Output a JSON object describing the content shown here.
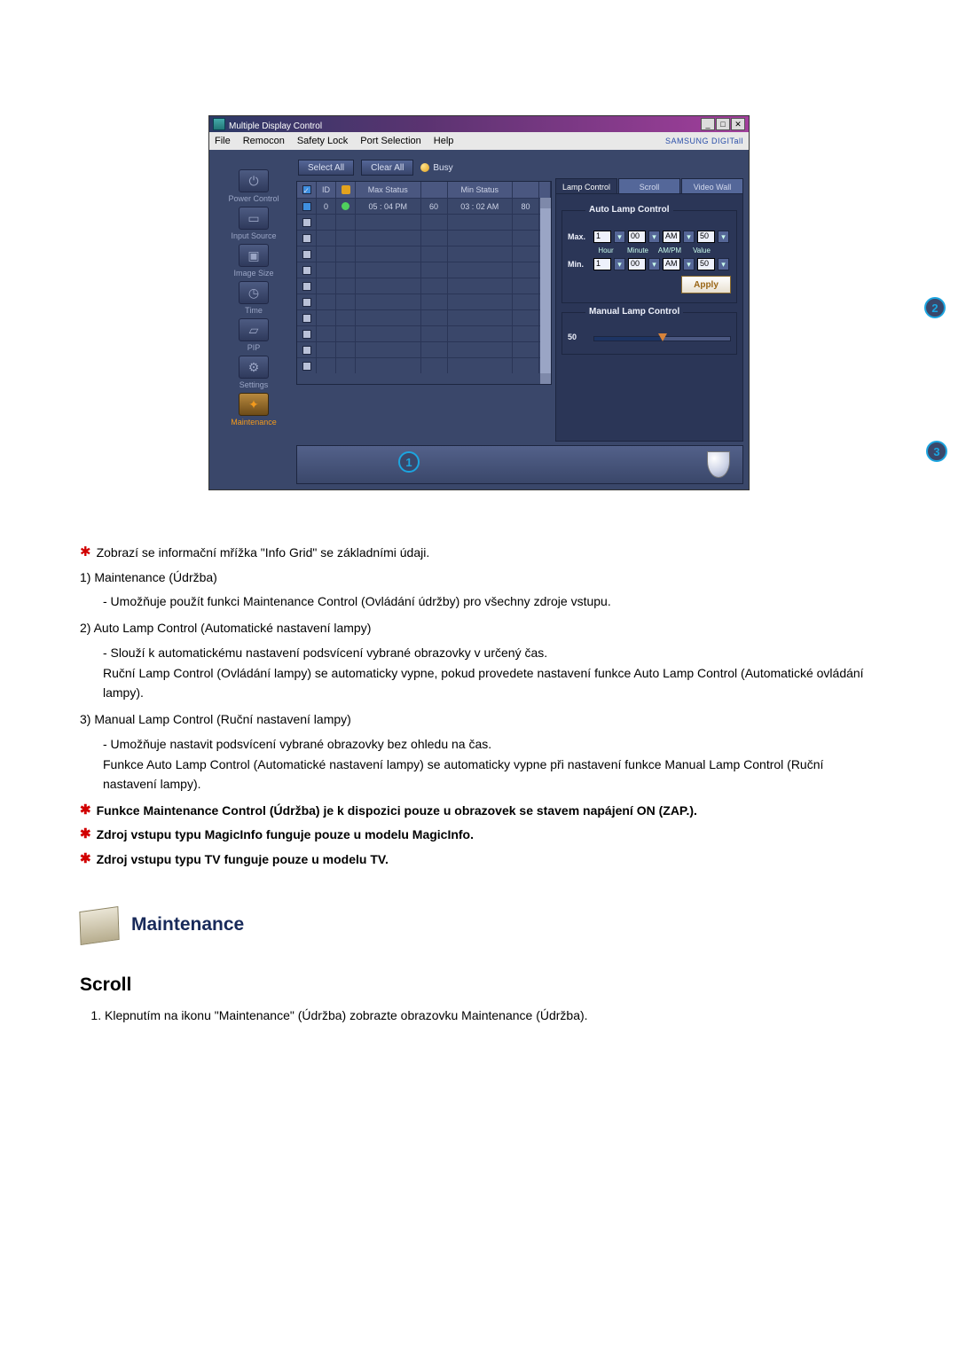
{
  "app": {
    "title": "Multiple Display Control",
    "brand": "SAMSUNG DIGITall"
  },
  "menu": {
    "file": "File",
    "remocon": "Remocon",
    "safety": "Safety Lock",
    "port": "Port Selection",
    "help": "Help"
  },
  "sidebar": {
    "items": [
      {
        "label": "Power Control",
        "glyph": "⏻"
      },
      {
        "label": "Input Source",
        "glyph": "▭"
      },
      {
        "label": "Image Size",
        "glyph": "▣"
      },
      {
        "label": "Time",
        "glyph": "◷"
      },
      {
        "label": "PIP",
        "glyph": "▱"
      },
      {
        "label": "Settings",
        "glyph": "⚙"
      },
      {
        "label": "Maintenance",
        "glyph": "✦"
      }
    ]
  },
  "toolbar": {
    "select_all": "Select All",
    "clear_all": "Clear All",
    "busy": "Busy"
  },
  "grid": {
    "headers": {
      "id": "ID",
      "max": "Max Status",
      "min": "Min Status"
    },
    "row": {
      "id": "0",
      "max": "05 : 04 PM",
      "maxv": "60",
      "min": "03 : 02 AM",
      "minv": "80"
    }
  },
  "right": {
    "tabs": {
      "lamp": "Lamp Control",
      "scroll": "Scroll",
      "video": "Video Wall"
    },
    "auto": {
      "title": "Auto Lamp Control",
      "max": "Max.",
      "min": "Min.",
      "hour": "1",
      "minute": "00",
      "ampm": "AM",
      "value": "50",
      "cap_hour": "Hour",
      "cap_min": "Minute",
      "cap_ampm": "AM/PM",
      "cap_val": "Value",
      "apply": "Apply"
    },
    "manual": {
      "title": "Manual Lamp Control",
      "value": "50"
    }
  },
  "callouts": {
    "c1": "1",
    "c2": "2",
    "c3": "3"
  },
  "doc": {
    "intro": "Zobrazí se informační mřížka \"Info Grid\" se základními údaji.",
    "n1": "1)  Maintenance (Údržba)",
    "n1a": "- Umožňuje použít funkci Maintenance Control (Ovládání údržby) pro všechny zdroje vstupu.",
    "n2": "2)  Auto Lamp Control (Automatické nastavení lampy)",
    "n2a": "- Slouží k automatickému nastavení podsvícení vybrané obrazovky v určený čas.",
    "n2b": "Ruční Lamp Control (Ovládání lampy) se automaticky vypne, pokud provedete nastavení funkce Auto Lamp Control (Automatické ovládání lampy).",
    "n3": "3)  Manual Lamp Control (Ruční nastavení lampy)",
    "n3a": "- Umožňuje nastavit podsvícení vybrané obrazovky bez ohledu na čas.",
    "n3b": "Funkce Auto Lamp Control (Automatické nastavení lampy) se automaticky vypne při nastavení funkce Manual Lamp Control (Ruční nastavení lampy).",
    "warn1": "Funkce Maintenance Control (Údržba) je k dispozici pouze u obrazovek se stavem napájení ON (ZAP.).",
    "warn2": "Zdroj vstupu typu MagicInfo funguje pouze u modelu MagicInfo.",
    "warn3": "Zdroj vstupu typu TV funguje pouze u modelu TV.",
    "section": "Maintenance",
    "scroll_head": "Scroll",
    "step1": "Klepnutím na ikonu \"Maintenance\" (Údržba) zobrazte obrazovku Maintenance (Údržba)."
  }
}
